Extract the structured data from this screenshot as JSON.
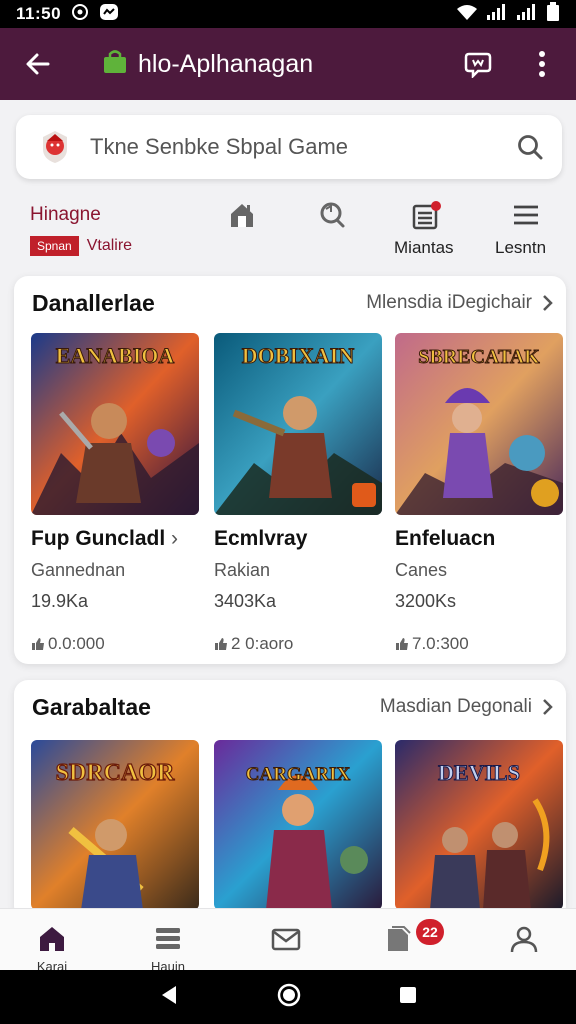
{
  "status_bar": {
    "time": "11:50"
  },
  "app_bar": {
    "title": "hlo-Aplhanagan"
  },
  "search": {
    "placeholder": "Tkne Senbke Sbpal Game"
  },
  "tabs": {
    "first": {
      "label": "Hinagne",
      "badge": "Spnan",
      "sub": "Vtalire"
    },
    "items": [
      {
        "icon": "house-icon",
        "label": ""
      },
      {
        "icon": "refresh-search-icon",
        "label": ""
      },
      {
        "icon": "list-icon",
        "label": "Miantas"
      },
      {
        "icon": "menu-icon",
        "label": "Lesntn"
      }
    ]
  },
  "section1": {
    "title": "Danallerlae",
    "more": "Mlensdia iDegichair",
    "games": [
      {
        "title": "Fup Guncladl",
        "category": "Gannednan",
        "size": "19.9Ka",
        "rating": "0.0:000",
        "art_text": "EANABIOA"
      },
      {
        "title": "Ecmlvray",
        "category": "Rakian",
        "size": "3403Ka",
        "rating": "2 0:aoro",
        "art_text": "DOBIXAIN"
      },
      {
        "title": "Enfeluacn",
        "category": "Canes",
        "size": "3200Ks",
        "rating": "7.0:300",
        "art_text": "SBRECATAK"
      }
    ]
  },
  "section2": {
    "title": "Garabaltae",
    "more": "Masdian Degonali",
    "games": [
      {
        "art_text": "SDRCAOR"
      },
      {
        "art_text": "CARGARIX"
      },
      {
        "art_text": "DEVILS"
      }
    ]
  },
  "bottom_nav": {
    "items": [
      {
        "icon": "home-icon",
        "label": "Karai"
      },
      {
        "icon": "stack-icon",
        "label": "Hauin"
      },
      {
        "icon": "mail-icon",
        "label": ""
      },
      {
        "icon": "downloads-icon",
        "label": "",
        "badge": "22"
      },
      {
        "icon": "profile-icon",
        "label": ""
      }
    ]
  },
  "colors": {
    "app_bar": "#4d1a3d",
    "accent": "#8a1530",
    "badge": "#d0202c"
  }
}
